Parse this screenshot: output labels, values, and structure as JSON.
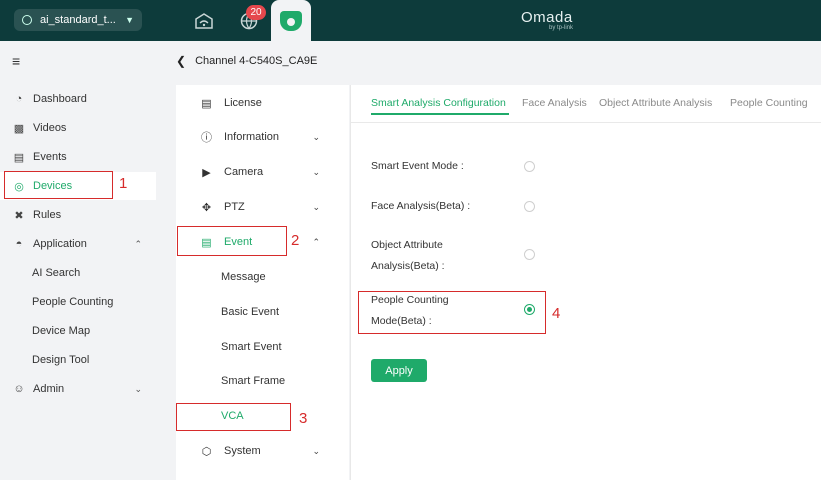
{
  "topbar": {
    "site_name": "ai_standard_t...",
    "notification_count": "20",
    "brand": "Omada",
    "brand_sub": "by tp-link"
  },
  "sidebar": {
    "items": [
      {
        "label": "Dashboard",
        "icon": "dashboard-icon"
      },
      {
        "label": "Videos",
        "icon": "video-icon"
      },
      {
        "label": "Events",
        "icon": "events-icon"
      },
      {
        "label": "Devices",
        "icon": "devices-icon"
      },
      {
        "label": "Rules",
        "icon": "rules-icon"
      },
      {
        "label": "Application",
        "icon": "application-icon"
      },
      {
        "label": "Admin",
        "icon": "admin-icon"
      }
    ],
    "application_sub": [
      "AI Search",
      "People Counting",
      "Device Map",
      "Design Tool"
    ]
  },
  "breadcrumb": {
    "title": "Channel 4-C540S_CA9E"
  },
  "settings_menu": {
    "items": [
      {
        "label": "License"
      },
      {
        "label": "Information"
      },
      {
        "label": "Camera"
      },
      {
        "label": "PTZ"
      },
      {
        "label": "Event"
      },
      {
        "label": "System"
      }
    ],
    "event_sub": [
      "Message",
      "Basic Event",
      "Smart Event",
      "Smart Frame",
      "VCA"
    ]
  },
  "tabs": [
    "Smart Analysis Configuration",
    "Face Analysis",
    "Object Attribute Analysis",
    "People Counting"
  ],
  "form": {
    "smart_event_mode": "Smart Event Mode :",
    "face_analysis": "Face Analysis(Beta) :",
    "object_attr_line1": "Object Attribute",
    "object_attr_line2": "Analysis(Beta) :",
    "people_counting_line1": "People Counting",
    "people_counting_line2": "Mode(Beta) :",
    "selected_mode": "People Counting Mode(Beta)",
    "apply_label": "Apply"
  },
  "annotations": [
    "1",
    "2",
    "3",
    "4"
  ],
  "colors": {
    "accent": "#1faa6a",
    "topbar": "#0d3b3b",
    "annotation": "#d62b2b"
  }
}
